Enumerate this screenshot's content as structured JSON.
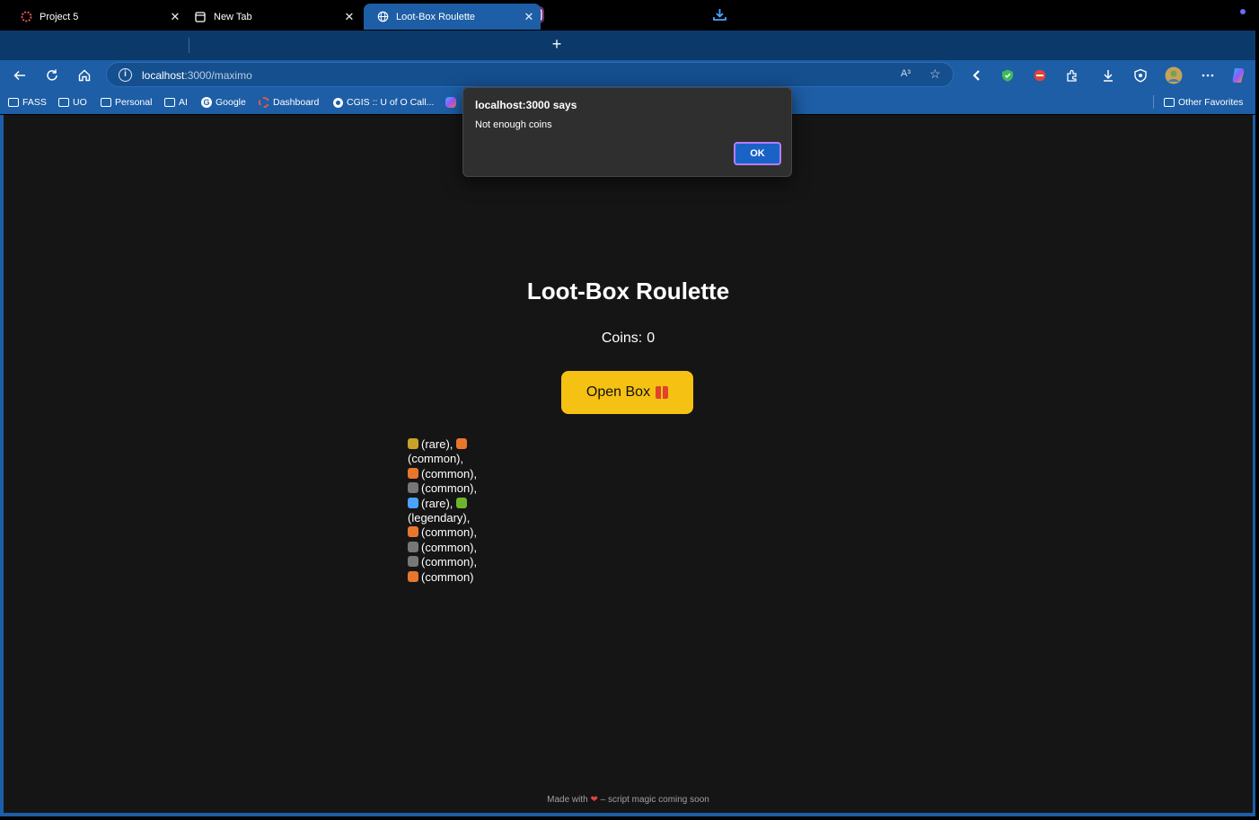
{
  "browser": {
    "tabs": [
      {
        "title": "Project 5",
        "active": false
      },
      {
        "title": "New Tab",
        "active": false
      },
      {
        "title": "Loot-Box Roulette",
        "active": true
      }
    ],
    "address": {
      "host": "localhost",
      "path": ":3000/maximo"
    },
    "read_aloud_label": "A³",
    "favorites": [
      {
        "label": "FASS",
        "icon": "folder-icon"
      },
      {
        "label": "UO",
        "icon": "folder-icon"
      },
      {
        "label": "Personal",
        "icon": "folder-icon"
      },
      {
        "label": "AI",
        "icon": "folder-icon"
      },
      {
        "label": "Google",
        "icon": "google-icon"
      },
      {
        "label": "Dashboard",
        "icon": "dashboard-icon"
      },
      {
        "label": "CGIS :: U of O Call...",
        "icon": "o-icon"
      }
    ],
    "other_favorites": "Other Favorites"
  },
  "page": {
    "title": "Loot-Box Roulette",
    "coins_label": "Coins:",
    "coins_value": "0",
    "open_box_label": "Open Box",
    "results": [
      {
        "item": "golden-idol",
        "rarity": "(rare),",
        "color": "#c9a227"
      },
      {
        "item": "carrot",
        "rarity": "(common),",
        "color": "#e8772e"
      },
      {
        "item": "carrot",
        "rarity": "(common),",
        "color": "#e8772e"
      },
      {
        "item": "rock",
        "rarity": "(common),",
        "color": "#777777"
      },
      {
        "item": "gem",
        "rarity": "(rare),",
        "color": "#4aa3ff"
      },
      {
        "item": "dragon",
        "rarity": "(legendary),",
        "color": "#6fb52c"
      },
      {
        "item": "carrot",
        "rarity": "(common),",
        "color": "#e8772e"
      },
      {
        "item": "rock",
        "rarity": "(common),",
        "color": "#777777"
      },
      {
        "item": "rock",
        "rarity": "(common),",
        "color": "#777777"
      },
      {
        "item": "carrot",
        "rarity": "(common)",
        "color": "#e8772e"
      }
    ],
    "footer_prefix": "Made with",
    "footer_suffix": "– script magic coming soon"
  },
  "dialog": {
    "title": "localhost:3000 says",
    "message": "Not enough coins",
    "ok_label": "OK"
  },
  "colors": {
    "accent_button": "#f5c112",
    "browser_chrome": "#1d5ea6",
    "page_bg": "#151515"
  }
}
